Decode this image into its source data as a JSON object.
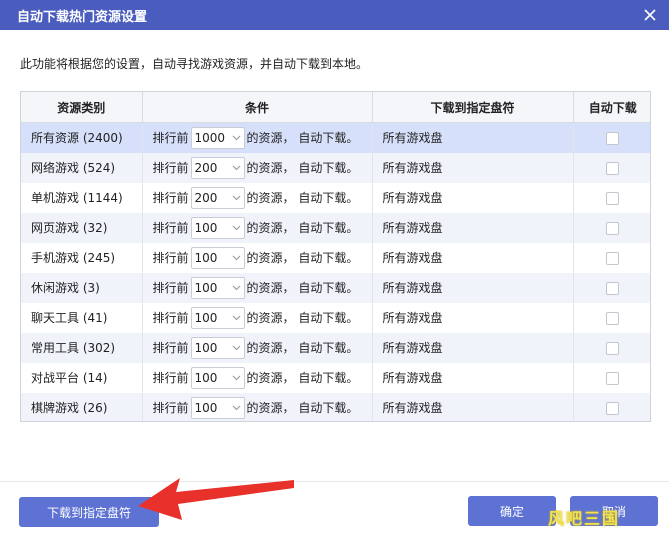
{
  "window": {
    "title": "自动下载热门资源设置",
    "close_icon": "close-icon"
  },
  "description": "此功能将根据您的设置，自动寻找游戏资源，并自动下载到本地。",
  "table": {
    "headers": [
      "资源类别",
      "条件",
      "下载到指定盘符",
      "自动下载"
    ],
    "cond_prefix": "排行前",
    "cond_suffix": "的资源，  自动下载。",
    "rows": [
      {
        "category": "所有资源 (2400)",
        "top_n": "1000",
        "drive": "所有游戏盘",
        "auto_download": false,
        "selected": true
      },
      {
        "category": "网络游戏 (524)",
        "top_n": "200",
        "drive": "所有游戏盘",
        "auto_download": false
      },
      {
        "category": "单机游戏 (1144)",
        "top_n": "200",
        "drive": "所有游戏盘",
        "auto_download": false
      },
      {
        "category": "网页游戏 (32)",
        "top_n": "100",
        "drive": "所有游戏盘",
        "auto_download": false
      },
      {
        "category": "手机游戏 (245)",
        "top_n": "100",
        "drive": "所有游戏盘",
        "auto_download": false
      },
      {
        "category": "休闲游戏 (3)",
        "top_n": "100",
        "drive": "所有游戏盘",
        "auto_download": false
      },
      {
        "category": "聊天工具 (41)",
        "top_n": "100",
        "drive": "所有游戏盘",
        "auto_download": false
      },
      {
        "category": "常用工具 (302)",
        "top_n": "100",
        "drive": "所有游戏盘",
        "auto_download": false
      },
      {
        "category": "对战平台 (14)",
        "top_n": "100",
        "drive": "所有游戏盘",
        "auto_download": false
      },
      {
        "category": "棋牌游戏 (26)",
        "top_n": "100",
        "drive": "所有游戏盘",
        "auto_download": false
      }
    ]
  },
  "buttons": {
    "download_to_drive": "下载到指定盘符",
    "ok": "确定",
    "cancel": "取消"
  },
  "watermark": "风吧三国",
  "colors": {
    "titlebar": "#4a5dbf",
    "button": "#5e72d4",
    "selected_row": "#d7e0fb",
    "arrow": "#e8312a"
  }
}
